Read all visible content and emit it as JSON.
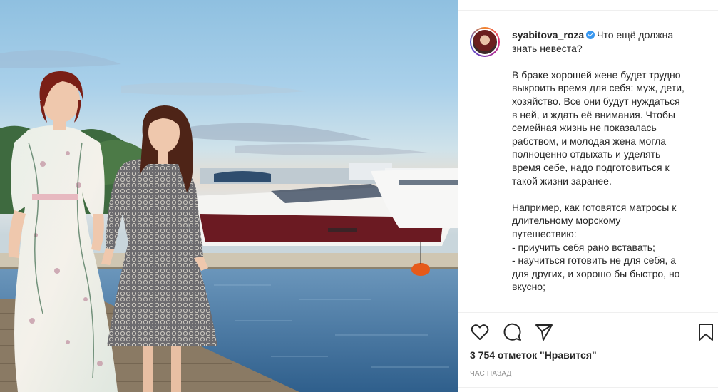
{
  "photo": {
    "alt_icon": "photo-two-women-yacht-pier"
  },
  "post": {
    "username": "syabitova_roza",
    "verified_icon": "verified-badge-icon",
    "title_lines": [
      "Что ещё должна",
      "знать невеста?"
    ],
    "paragraph1": [
      "В браке хорошей жене будет трудно",
      "выкроить время для себя: муж, дети,",
      "хозяйство. Все они будут нуждаться",
      "в ней, и ждать её внимания. Чтобы",
      "семейная жизнь не показалась",
      "рабством, и молодая жена могла",
      "полноценно отдыхать и уделять",
      "время себе, надо подготовиться к",
      "такой жизни заранее."
    ],
    "paragraph2": [
      "Например, как готовятся матросы к",
      "длительному морскому",
      "путешествию:",
      "- приучить себя рано вставать;",
      "- научиться готовить не для себя, а",
      "для других, и хорошо бы быстро, но",
      "вкусно;"
    ]
  },
  "actions": {
    "like_icon": "heart-icon",
    "comment_icon": "comment-icon",
    "share_icon": "paper-plane-icon",
    "save_icon": "bookmark-icon"
  },
  "likes_text": "3 754 отметок \"Нравится\"",
  "timestamp": "час назад",
  "colors": {
    "verified": "#3897f0",
    "text": "#262626",
    "muted": "#8e8e8e",
    "divider": "#efefef"
  }
}
